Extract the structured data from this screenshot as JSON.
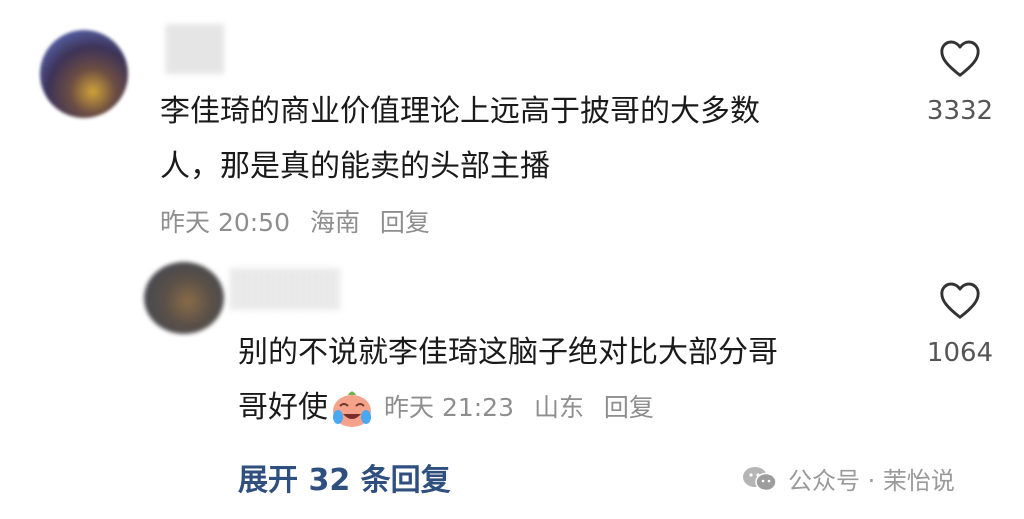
{
  "comment": {
    "text_line1": "李佳琦的商业价值理论上远高于披哥的大多数",
    "text_line2": "人，那是真的能卖的头部主播",
    "time": "昨天 20:50",
    "location": "海南",
    "reply_label": "回复",
    "likes": "3332"
  },
  "reply": {
    "text_line1": "别的不说就李佳琦这脑子绝对比大部分哥",
    "text_line2": "哥好使",
    "emoji": "crying-laughing-face",
    "time": "昨天 21:23",
    "location": "山东",
    "reply_label": "回复",
    "likes": "1064"
  },
  "expand_label": "展开 32 条回复",
  "watermark": {
    "text": "公众号 · 茉怡说",
    "icon": "wechat-icon"
  }
}
